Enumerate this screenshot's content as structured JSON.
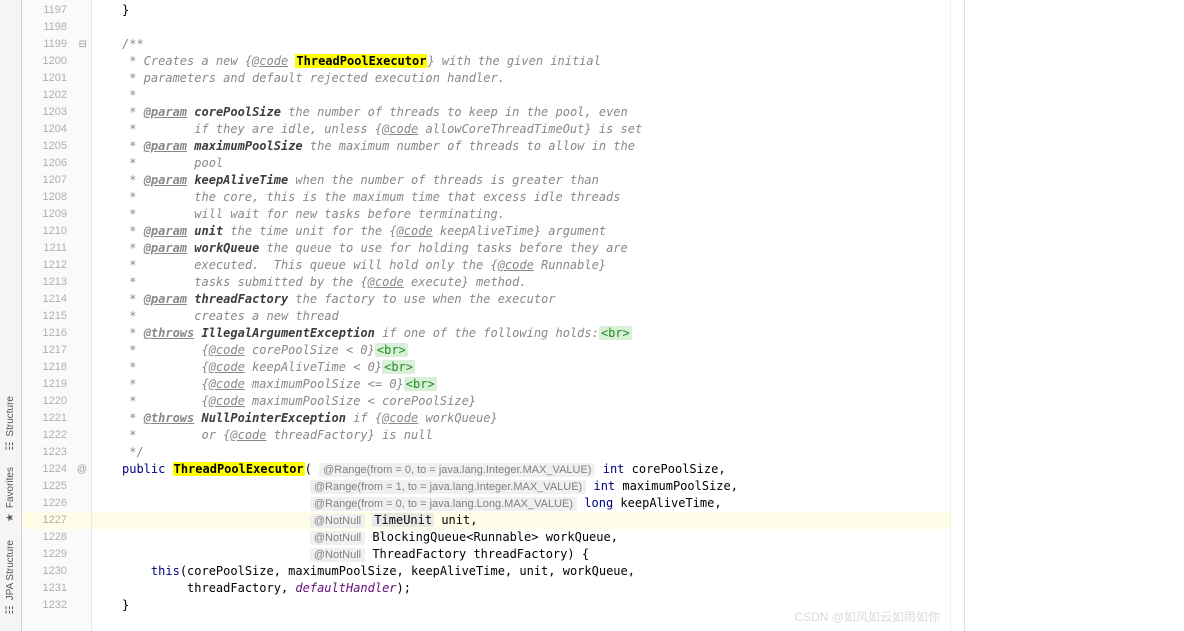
{
  "sideTabs": [
    {
      "label": "Structure",
      "icon": "☷"
    },
    {
      "label": "Favorites",
      "icon": "★"
    },
    {
      "label": "JPA Structure",
      "icon": "☷"
    }
  ],
  "gutter": {
    "start": 1197,
    "end": 1232,
    "highlightLine": 1227,
    "overrideMarkerLine": 1224,
    "overrideMarker": "@",
    "collapseMarkerLine": 1199,
    "collapseMarker": "⊟"
  },
  "code": {
    "highlightLine": 1227,
    "l1197": "}",
    "l1198": "",
    "l1199_c": "/**",
    "l1200_a": " * Creates a new {",
    "l1200_b": "@code",
    "l1200_c": " ",
    "l1200_hl": "ThreadPoolExecutor",
    "l1200_d": "} with the given initial",
    "l1201": " * parameters and default rejected execution handler.",
    "l1202": " *",
    "l1203_a": " * ",
    "l1203_tag": "@param",
    "l1203_p": " corePoolSize",
    "l1203_b": " the number of threads to keep in the pool, even",
    "l1204_a": " *        if they are idle, unless {",
    "l1204_b": "@code",
    "l1204_c": " allowCoreThreadTimeOut} is set",
    "l1205_a": " * ",
    "l1205_tag": "@param",
    "l1205_p": " maximumPoolSize",
    "l1205_b": " the maximum number of threads to allow in the",
    "l1206": " *        pool",
    "l1207_a": " * ",
    "l1207_tag": "@param",
    "l1207_p": " keepAliveTime",
    "l1207_b": " when the number of threads is greater than",
    "l1208": " *        the core, this is the maximum time that excess idle threads",
    "l1209": " *        will wait for new tasks before terminating.",
    "l1210_a": " * ",
    "l1210_tag": "@param",
    "l1210_p": " unit",
    "l1210_b": " the time unit for the {",
    "l1210_c": "@code",
    "l1210_d": " keepAliveTime} argument",
    "l1211_a": " * ",
    "l1211_tag": "@param",
    "l1211_p": " workQueue",
    "l1211_b": " the queue to use for holding tasks before they are",
    "l1212_a": " *        executed.  This queue will hold only the {",
    "l1212_b": "@code",
    "l1212_c": " Runnable}",
    "l1213_a": " *        tasks submitted by the {",
    "l1213_b": "@code",
    "l1213_c": " execute} method.",
    "l1214_a": " * ",
    "l1214_tag": "@param",
    "l1214_p": " threadFactory",
    "l1214_b": " the factory to use when the executor",
    "l1215": " *        creates a new thread",
    "l1216_a": " * ",
    "l1216_tag": "@throws",
    "l1216_p": " IllegalArgumentException",
    "l1216_b": " if one of the following holds:",
    "l1216_br": "<br>",
    "l1217_a": " *         {",
    "l1217_b": "@code",
    "l1217_c": " corePoolSize < 0}",
    "l1217_br": "<br>",
    "l1218_a": " *         {",
    "l1218_b": "@code",
    "l1218_c": " keepAliveTime < 0}",
    "l1218_br": "<br>",
    "l1219_a": " *         {",
    "l1219_b": "@code",
    "l1219_c": " maximumPoolSize <= 0}",
    "l1219_br": "<br>",
    "l1220_a": " *         {",
    "l1220_b": "@code",
    "l1220_c": " maximumPoolSize < corePoolSize}",
    "l1221_a": " * ",
    "l1221_tag": "@throws",
    "l1221_p": " NullPointerException",
    "l1221_b": " if {",
    "l1221_c": "@code",
    "l1221_d": " workQueue}",
    "l1222_a": " *         or {",
    "l1222_b": "@code",
    "l1222_c": " threadFactory} is null",
    "l1223": " */",
    "l1224_pub": "public",
    "l1224_sp": " ",
    "l1224_hl": "ThreadPoolExecutor",
    "l1224_op": "( ",
    "l1224_anno": "@Range(from = 0, to = java.lang.Integer.MAX_VALUE)",
    "l1224_sp2": " ",
    "l1224_int": "int",
    "l1224_rest": " corePoolSize,",
    "l1225_pad": "                          ",
    "l1225_anno": "@Range(from = 1, to = java.lang.Integer.MAX_VALUE)",
    "l1225_sp": " ",
    "l1225_int": "int",
    "l1225_rest": " maximumPoolSize,",
    "l1226_pad": "                          ",
    "l1226_anno": "@Range(from = 0, to = java.lang.Long.MAX_VALUE)",
    "l1226_sp": " ",
    "l1226_long": "long",
    "l1226_rest": " keepAliveTime,",
    "l1227_pad": "                          ",
    "l1227_anno": "@NotNull",
    "l1227_sp": " ",
    "l1227_type": "TimeUnit",
    "l1227_rest": " unit,",
    "l1228_pad": "                          ",
    "l1228_anno": "@NotNull",
    "l1228_sp": " ",
    "l1228_type": "BlockingQueue<Runnable> workQueue,",
    "l1229_pad": "                          ",
    "l1229_anno": "@NotNull",
    "l1229_sp": " ",
    "l1229_type": "ThreadFactory threadFactory) {",
    "l1230_a": "    ",
    "l1230_this": "this",
    "l1230_b": "(corePoolSize, maximumPoolSize, keepAliveTime, unit, workQueue,",
    "l1231_a": "         threadFactory, ",
    "l1231_ident": "defaultHandler",
    "l1231_b": ");",
    "l1232": "}"
  },
  "watermark": "CSDN @如风如云如雨如你"
}
